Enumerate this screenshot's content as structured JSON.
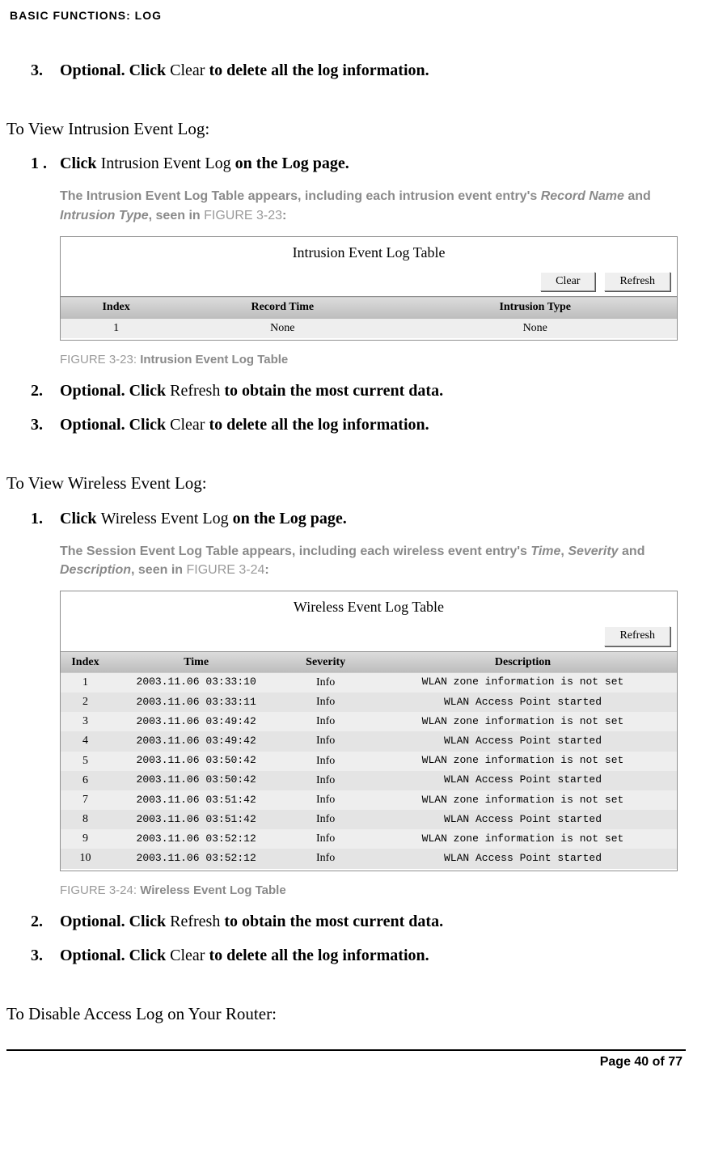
{
  "running_head": "BASIC FUNCTIONS: LOG",
  "top_step": {
    "num": "3.",
    "pre": "Optional. Click ",
    "mid": "Clear",
    "post": " to delete all the log information."
  },
  "sectionA": {
    "heading": "To View Intrusion Event Log:",
    "step1": {
      "num": "1 .",
      "pre": "Click ",
      "mid": "Intrusion Event Log",
      "post": " on the Log page."
    },
    "gray": {
      "t1": "The Intrusion Event Log Table appears, including each intrusion event entry's ",
      "i1": "Record Name",
      "t2": " and ",
      "i2": "Intrusion Type",
      "t3": ", seen in ",
      "fig": "FIGURE 3-23",
      "t4": ":"
    },
    "figure": {
      "title": "Intrusion Event Log Table",
      "buttons": {
        "clear": "Clear",
        "refresh": "Refresh"
      },
      "headers": [
        "Index",
        "Record Time",
        "Intrusion Type"
      ],
      "rows": [
        [
          "1",
          "None",
          "None"
        ]
      ],
      "caption_prefix": "FIGURE 3-23: ",
      "caption_strong": "Intrusion Event Log Table"
    },
    "step2": {
      "num": "2.",
      "pre": "Optional. Click ",
      "mid": "Refresh",
      "post": " to obtain the most current data."
    },
    "step3": {
      "num": "3.",
      "pre": "Optional. Click ",
      "mid": "Clear",
      "post": " to delete all the log information."
    }
  },
  "sectionB": {
    "heading": "To View Wireless Event Log:",
    "step1": {
      "num": "1.",
      "pre": "Click ",
      "mid": "Wireless Event Log",
      "post": " on the Log page."
    },
    "gray": {
      "t1": "The Session Event Log Table appears, including each wireless event entry's ",
      "i1": "Time",
      "t2": ", ",
      "i2": "Severity",
      "t3": " and ",
      "i3": "Description",
      "t4": ", seen in ",
      "fig": "FIGURE 3-24",
      "t5": ":"
    },
    "figure": {
      "title": "Wireless Event Log Table",
      "buttons": {
        "refresh": "Refresh"
      },
      "headers": [
        "Index",
        "Time",
        "Severity",
        "Description"
      ],
      "rows": [
        [
          "1",
          "2003.11.06 03:33:10",
          "Info",
          "WLAN zone information is not set"
        ],
        [
          "2",
          "2003.11.06 03:33:11",
          "Info",
          "WLAN Access Point started"
        ],
        [
          "3",
          "2003.11.06 03:49:42",
          "Info",
          "WLAN zone information is not set"
        ],
        [
          "4",
          "2003.11.06 03:49:42",
          "Info",
          "WLAN Access Point started"
        ],
        [
          "5",
          "2003.11.06 03:50:42",
          "Info",
          "WLAN zone information is not set"
        ],
        [
          "6",
          "2003.11.06 03:50:42",
          "Info",
          "WLAN Access Point started"
        ],
        [
          "7",
          "2003.11.06 03:51:42",
          "Info",
          "WLAN zone information is not set"
        ],
        [
          "8",
          "2003.11.06 03:51:42",
          "Info",
          "WLAN Access Point started"
        ],
        [
          "9",
          "2003.11.06 03:52:12",
          "Info",
          "WLAN zone information is not set"
        ],
        [
          "10",
          "2003.11.06 03:52:12",
          "Info",
          "WLAN Access Point started"
        ]
      ],
      "caption_prefix": "FIGURE 3-24: ",
      "caption_strong": "Wireless Event Log Table"
    },
    "step2": {
      "num": "2.",
      "pre": "Optional. Click ",
      "mid": "Refresh",
      "post": " to obtain the most current data."
    },
    "step3": {
      "num": "3.",
      "pre": "Optional. Click ",
      "mid": "Clear",
      "post": " to delete all the log information."
    }
  },
  "sectionC": {
    "heading": "To Disable Access Log on Your Router:"
  },
  "footer": "Page 40 of 77"
}
